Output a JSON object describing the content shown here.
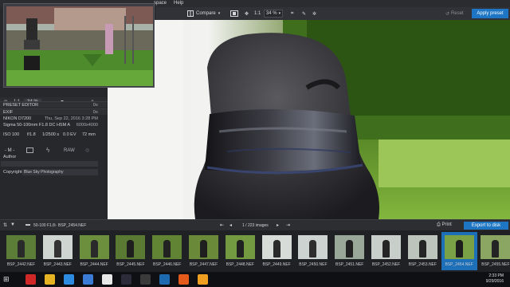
{
  "menu": {
    "items": [
      "space",
      "Help"
    ]
  },
  "toolbar": {
    "compare_label": "Compare",
    "ratio_label": "1:1",
    "zoom_value": "34 %",
    "reset_label": "Reset",
    "apply_label": "Apply preset"
  },
  "navigator": {
    "ratio_label": "1:1",
    "zoom_value": "34 %"
  },
  "panels": {
    "preset_editor": "PRESET EDITOR",
    "exif": "EXIF",
    "camera": "NIKON D7200",
    "date": "Thu, Sep 22, 2016 3:28 PM",
    "lens": "Sigma 50-100mm F1.8 DC HSM A",
    "dimensions": "6000x4000",
    "iso": "ISO 100",
    "aperture": "f/1.8",
    "shutter": "1/2500 s",
    "ev": "0.0 EV",
    "focal": "72 mm",
    "mode": "- M -",
    "raw": "RAW",
    "author_label": "Author",
    "author_value": "",
    "copyright_label": "Copyright",
    "copyright_value": "Blue Sky Photography"
  },
  "filmbar": {
    "folder": "50-100 F1.8",
    "file": "BSP_2454.NEF",
    "counter": "1 / 223 images",
    "print_label": "Print",
    "export_label": "Export to disk"
  },
  "thumbs": [
    {
      "name": "BSP_2442.NEF",
      "selected": false
    },
    {
      "name": "BSP_2443.NEF",
      "selected": false
    },
    {
      "name": "BSP_2444.NEF",
      "selected": false
    },
    {
      "name": "BSP_2445.NEF",
      "selected": false
    },
    {
      "name": "BSP_2446.NEF",
      "selected": false
    },
    {
      "name": "BSP_2447.NEF",
      "selected": false
    },
    {
      "name": "BSP_2448.NEF",
      "selected": false
    },
    {
      "name": "BSP_2449.NEF",
      "selected": false
    },
    {
      "name": "BSP_2450.NEF",
      "selected": false
    },
    {
      "name": "BSP_2451.NEF",
      "selected": false
    },
    {
      "name": "BSP_2452.NEF",
      "selected": false
    },
    {
      "name": "BSP_2453.NEF",
      "selected": false
    },
    {
      "name": "BSP_2454.NEF",
      "selected": true
    },
    {
      "name": "BSP_2455.NEF",
      "selected": false
    }
  ],
  "taskbar": {
    "time": "2:33 PM",
    "date": "9/29/2016",
    "icons": [
      "opera-icon",
      "folder-icon",
      "chrome-icon",
      "mail-icon",
      "app-18-icon",
      "lightroom-icon",
      "media-icon",
      "terminal-icon",
      "slides-icon",
      "browser-icon"
    ]
  },
  "colors": {
    "accent": "#1d75c4",
    "panel": "#26282c"
  }
}
